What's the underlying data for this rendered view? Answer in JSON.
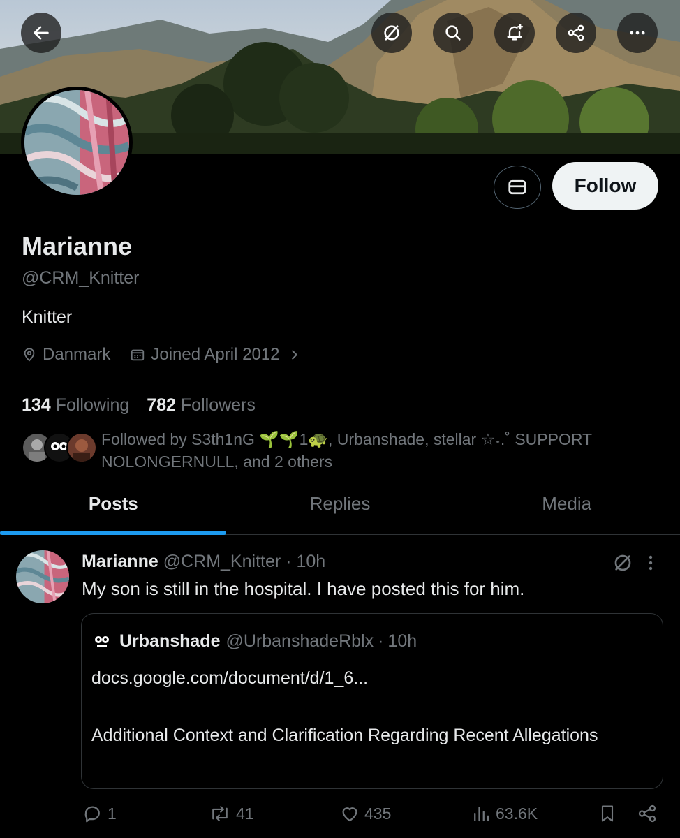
{
  "topbar": {
    "icons": [
      "back-arrow-icon",
      "circle-slash-icon",
      "search-icon",
      "bell-plus-icon",
      "share-icon",
      "more-icon"
    ]
  },
  "profile": {
    "name": "Marianne",
    "handle": "@CRM_Knitter",
    "bio": "Knitter",
    "location": "Danmark",
    "joined": "Joined April 2012",
    "follow_label": "Follow",
    "following_count": "134",
    "following_label": "Following",
    "followers_count": "782",
    "followers_label": "Followers",
    "followed_by_text": "Followed by S3th1nG 🌱🌱1🐢, Urbanshade, stellar ☆˖.˚ SUPPORT NOLONGERNULL, and 2 others"
  },
  "tabs": [
    {
      "label": "Posts",
      "active": true
    },
    {
      "label": "Replies",
      "active": false
    },
    {
      "label": "Media",
      "active": false
    }
  ],
  "post": {
    "author": "Marianne",
    "handle": "@CRM_Knitter",
    "separator": "·",
    "time": "10h",
    "text": "My son is still in the hospital. I have posted this for him.",
    "quote": {
      "author": "Urbanshade",
      "handle": "@UrbanshadeRblx",
      "time": "10h",
      "link": "docs.google.com/document/d/1_6...",
      "title": "Additional Context and Clarification Regarding Recent Allegations"
    },
    "replies": "1",
    "reposts": "41",
    "likes": "435",
    "views": "63.6K"
  },
  "colors": {
    "background": "#000000",
    "text": "#e7e9ea",
    "muted": "#71767b",
    "accent": "#1d9bf0",
    "border": "#2f3336"
  }
}
